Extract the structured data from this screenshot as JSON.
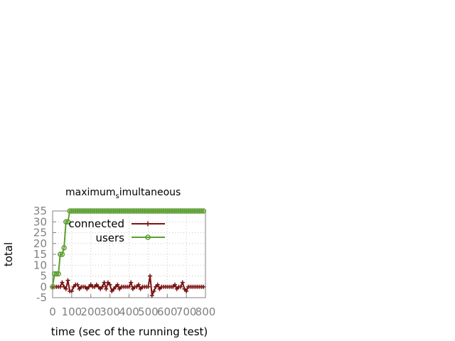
{
  "chart_data": {
    "type": "line",
    "title": "maximum",
    "title_subscript": "s",
    "title_suffix": "imultaneous",
    "xlabel": "time (sec of the running test)",
    "ylabel": "total",
    "xlim": [
      0,
      800
    ],
    "ylim": [
      -5,
      35
    ],
    "x_ticks": [
      "0",
      "100",
      "200",
      "300",
      "400",
      "500",
      "600",
      "700",
      "800"
    ],
    "y_ticks": [
      "-5",
      "0",
      "5",
      "10",
      "15",
      "20",
      "25",
      "30",
      "35"
    ],
    "x_tick_values": [
      0,
      100,
      200,
      300,
      400,
      500,
      600,
      700,
      800
    ],
    "y_tick_values": [
      -5,
      0,
      5,
      10,
      15,
      20,
      25,
      30,
      35
    ],
    "grid": true,
    "legend_position": "top-left",
    "series": [
      {
        "name": "connected",
        "color": "#7a1414",
        "marker": "plus",
        "points": [
          [
            0,
            0
          ],
          [
            10,
            0
          ],
          [
            20,
            0
          ],
          [
            30,
            0
          ],
          [
            40,
            0
          ],
          [
            50,
            2
          ],
          [
            60,
            0
          ],
          [
            70,
            -1
          ],
          [
            80,
            3
          ],
          [
            90,
            -2
          ],
          [
            100,
            -2
          ],
          [
            110,
            0
          ],
          [
            120,
            1
          ],
          [
            130,
            1
          ],
          [
            140,
            -1
          ],
          [
            150,
            0
          ],
          [
            160,
            0
          ],
          [
            170,
            0
          ],
          [
            180,
            -1
          ],
          [
            190,
            0
          ],
          [
            200,
            1
          ],
          [
            210,
            0
          ],
          [
            220,
            0
          ],
          [
            230,
            1
          ],
          [
            240,
            0
          ],
          [
            250,
            -1
          ],
          [
            260,
            0
          ],
          [
            270,
            2
          ],
          [
            280,
            -1
          ],
          [
            290,
            2
          ],
          [
            300,
            1
          ],
          [
            310,
            -2
          ],
          [
            320,
            -1
          ],
          [
            330,
            0
          ],
          [
            340,
            1
          ],
          [
            350,
            -1
          ],
          [
            360,
            0
          ],
          [
            370,
            0
          ],
          [
            380,
            0
          ],
          [
            390,
            0
          ],
          [
            400,
            0
          ],
          [
            410,
            2
          ],
          [
            420,
            -1
          ],
          [
            430,
            0
          ],
          [
            440,
            0
          ],
          [
            450,
            1
          ],
          [
            460,
            -1
          ],
          [
            470,
            0
          ],
          [
            480,
            0
          ],
          [
            490,
            0
          ],
          [
            500,
            0
          ],
          [
            510,
            5
          ],
          [
            520,
            -4
          ],
          [
            530,
            -2
          ],
          [
            540,
            0
          ],
          [
            550,
            1
          ],
          [
            560,
            -1
          ],
          [
            570,
            0
          ],
          [
            580,
            0
          ],
          [
            590,
            0
          ],
          [
            600,
            0
          ],
          [
            610,
            0
          ],
          [
            620,
            0
          ],
          [
            630,
            0
          ],
          [
            640,
            1
          ],
          [
            650,
            -1
          ],
          [
            660,
            0
          ],
          [
            670,
            0
          ],
          [
            680,
            2
          ],
          [
            690,
            -1
          ],
          [
            700,
            -2
          ],
          [
            710,
            0
          ],
          [
            720,
            0
          ],
          [
            730,
            0
          ],
          [
            740,
            0
          ],
          [
            750,
            0
          ],
          [
            760,
            0
          ],
          [
            770,
            0
          ],
          [
            780,
            0
          ],
          [
            790,
            0
          ]
        ]
      },
      {
        "name": "users",
        "color": "#5c9e31",
        "marker": "circle",
        "points": [
          [
            0,
            0
          ],
          [
            10,
            6
          ],
          [
            20,
            6
          ],
          [
            30,
            6
          ],
          [
            40,
            15
          ],
          [
            50,
            15
          ],
          [
            60,
            18
          ],
          [
            70,
            30
          ],
          [
            80,
            30
          ],
          [
            90,
            35
          ],
          [
            100,
            35
          ],
          [
            110,
            35
          ],
          [
            120,
            35
          ],
          [
            130,
            35
          ],
          [
            140,
            35
          ],
          [
            150,
            35
          ],
          [
            160,
            35
          ],
          [
            170,
            35
          ],
          [
            180,
            35
          ],
          [
            190,
            35
          ],
          [
            200,
            35
          ],
          [
            210,
            35
          ],
          [
            220,
            35
          ],
          [
            230,
            35
          ],
          [
            240,
            35
          ],
          [
            250,
            35
          ],
          [
            260,
            35
          ],
          [
            270,
            35
          ],
          [
            280,
            35
          ],
          [
            290,
            35
          ],
          [
            300,
            35
          ],
          [
            310,
            35
          ],
          [
            320,
            35
          ],
          [
            330,
            35
          ],
          [
            340,
            35
          ],
          [
            350,
            35
          ],
          [
            360,
            35
          ],
          [
            370,
            35
          ],
          [
            380,
            35
          ],
          [
            390,
            35
          ],
          [
            400,
            35
          ],
          [
            410,
            35
          ],
          [
            420,
            35
          ],
          [
            430,
            35
          ],
          [
            440,
            35
          ],
          [
            450,
            35
          ],
          [
            460,
            35
          ],
          [
            470,
            35
          ],
          [
            480,
            35
          ],
          [
            490,
            35
          ],
          [
            500,
            35
          ],
          [
            510,
            35
          ],
          [
            520,
            35
          ],
          [
            530,
            35
          ],
          [
            540,
            35
          ],
          [
            550,
            35
          ],
          [
            560,
            35
          ],
          [
            570,
            35
          ],
          [
            580,
            35
          ],
          [
            590,
            35
          ],
          [
            600,
            35
          ],
          [
            610,
            35
          ],
          [
            620,
            35
          ],
          [
            630,
            35
          ],
          [
            640,
            35
          ],
          [
            650,
            35
          ],
          [
            660,
            35
          ],
          [
            670,
            35
          ],
          [
            680,
            35
          ],
          [
            690,
            35
          ],
          [
            700,
            35
          ],
          [
            710,
            35
          ],
          [
            720,
            35
          ],
          [
            730,
            35
          ],
          [
            740,
            35
          ],
          [
            750,
            35
          ],
          [
            760,
            35
          ],
          [
            770,
            35
          ],
          [
            780,
            35
          ],
          [
            790,
            35
          ]
        ]
      }
    ]
  }
}
